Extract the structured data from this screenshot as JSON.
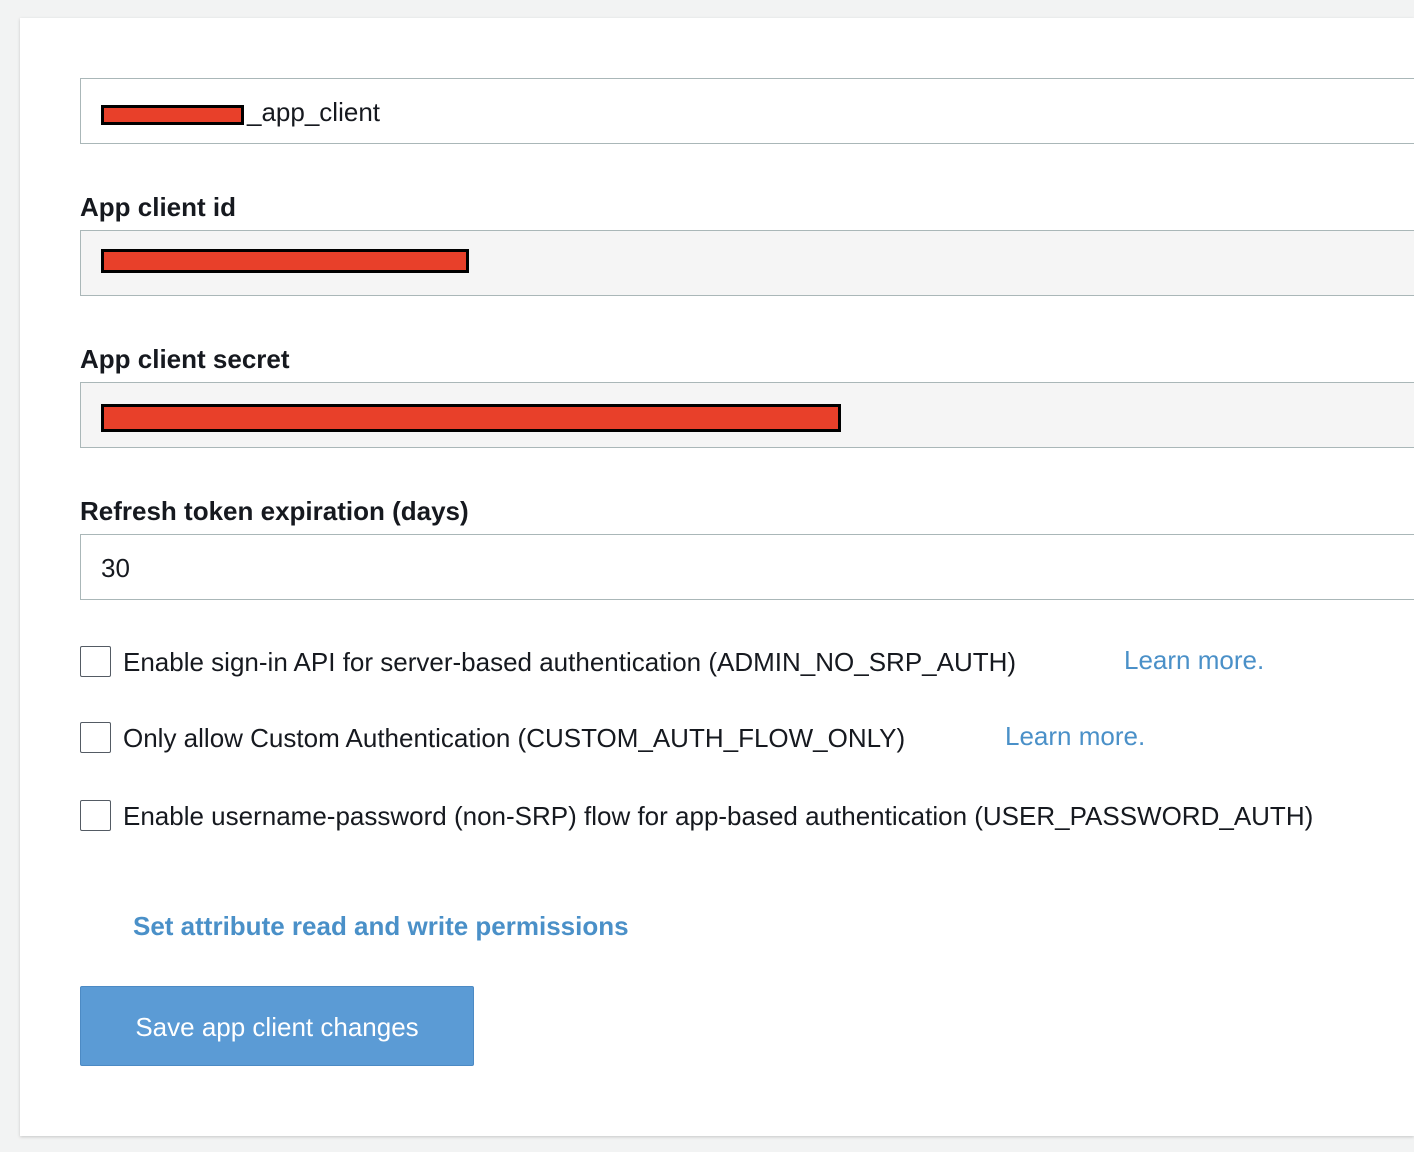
{
  "app_client_name": {
    "value_suffix": "_app_client"
  },
  "app_client_id": {
    "label": "App client id"
  },
  "app_client_secret": {
    "label": "App client secret"
  },
  "refresh_token": {
    "label": "Refresh token expiration (days)",
    "value": "30"
  },
  "options": [
    {
      "label": "Enable sign-in API for server-based authentication (ADMIN_NO_SRP_AUTH)",
      "learn_more": "Learn more.",
      "checked": false
    },
    {
      "label": "Only allow Custom Authentication (CUSTOM_AUTH_FLOW_ONLY)",
      "learn_more": "Learn more.",
      "checked": false
    },
    {
      "label": "Enable username-password (non-SRP) flow for app-based authentication (USER_PASSWORD_AUTH)",
      "checked": false
    }
  ],
  "attribute_permissions_link": "Set attribute read and write permissions",
  "save_button": "Save app client changes",
  "colors": {
    "link": "#4a90c8",
    "primary_button": "#5b9bd5",
    "redaction": "#e8402a"
  }
}
